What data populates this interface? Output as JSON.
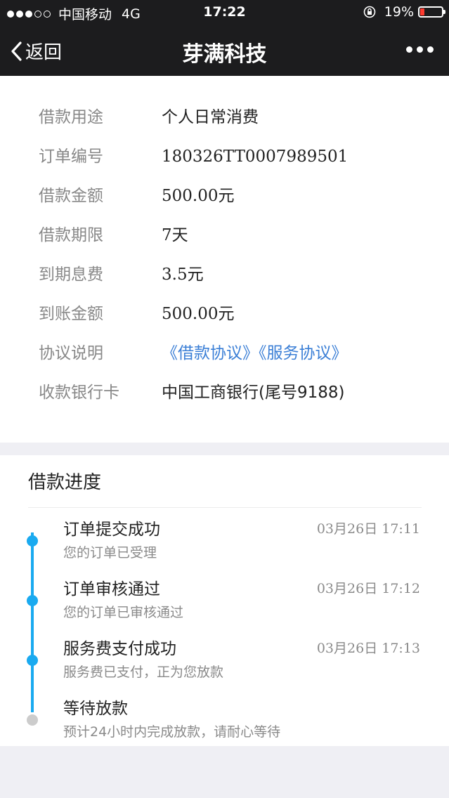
{
  "status_bar": {
    "carrier": "中国移动",
    "network": "4G",
    "time": "17:22",
    "battery_percent": "19%",
    "battery_level": 0.19,
    "battery_color": "#ff3b30"
  },
  "nav": {
    "back_label": "返回",
    "title": "芽满科技",
    "back_icon": "chevron-left-icon",
    "more_icon": "more-dots-icon"
  },
  "details": {
    "rows": [
      {
        "label": "借款用途",
        "value": "个人日常消费"
      },
      {
        "label": "订单编号",
        "value": "180326TT0007989501"
      },
      {
        "label": "借款金额",
        "value": "500.00元"
      },
      {
        "label": "借款期限",
        "value": "7天"
      },
      {
        "label": "到期息费",
        "value": "3.5元"
      },
      {
        "label": "到账金额",
        "value": "500.00元"
      },
      {
        "label": "协议说明",
        "links": [
          "《借款协议》",
          "《服务协议》"
        ]
      },
      {
        "label": "收款银行卡",
        "value": "中国工商银行(尾号9188)"
      }
    ],
    "link_color": "#3b7fd6"
  },
  "progress": {
    "title": "借款进度",
    "active_color": "#1aaaf0",
    "pending_color": "#cccccc",
    "steps": [
      {
        "title": "订单提交成功",
        "desc": "您的订单已受理",
        "time": "03月26日 17:11",
        "done": true
      },
      {
        "title": "订单审核通过",
        "desc": "您的订单已审核通过",
        "time": "03月26日 17:12",
        "done": true
      },
      {
        "title": "服务费支付成功",
        "desc": "服务费已支付，正为您放款",
        "time": "03月26日 17:13",
        "done": true
      },
      {
        "title": "等待放款",
        "desc": "预计24小时内完成放款，请耐心等待",
        "time": "",
        "done": false
      }
    ]
  }
}
